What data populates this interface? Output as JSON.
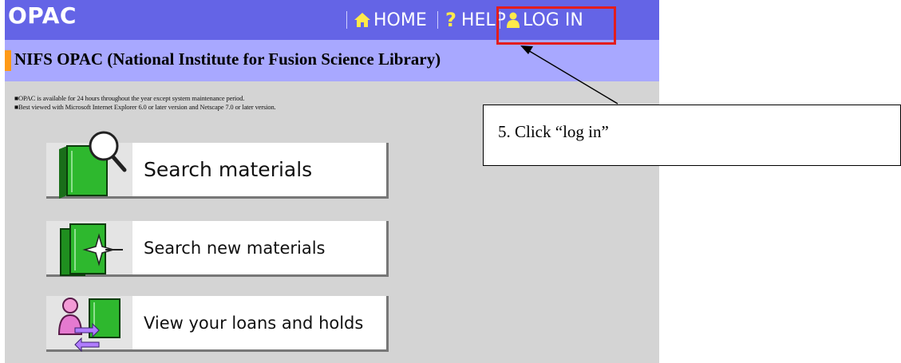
{
  "header": {
    "logo": "OPAC",
    "nav": {
      "home": "HOME",
      "help_mark": "?",
      "help": "HELP",
      "login": "LOG IN"
    }
  },
  "title": "NIFS OPAC (National Institute for Fusion Science Library)",
  "notices": [
    "■OPAC is available for 24 hours throughout the year except system maintenance period.",
    "■Best viewed with Microsoft Internet Explorer 6.0 or later version and Netscape 7.0 or later version."
  ],
  "menu": [
    {
      "label": "Search materials",
      "icon": "book-magnifier-icon"
    },
    {
      "label": "Search new materials",
      "icon": "new-books-sparkle-icon"
    },
    {
      "label": "View your loans and holds",
      "icon": "person-books-exchange-icon"
    }
  ],
  "annotation": {
    "text": "5. Click “log in”",
    "highlight_color": "#e31d1d"
  },
  "colors": {
    "top_bar": "#6464e6",
    "title_bar": "#a8a8ff",
    "title_accent": "#ff9a16",
    "page_bg": "#d4d4d4",
    "book_green": "#29a829",
    "home_icon": "#ffe94a"
  }
}
